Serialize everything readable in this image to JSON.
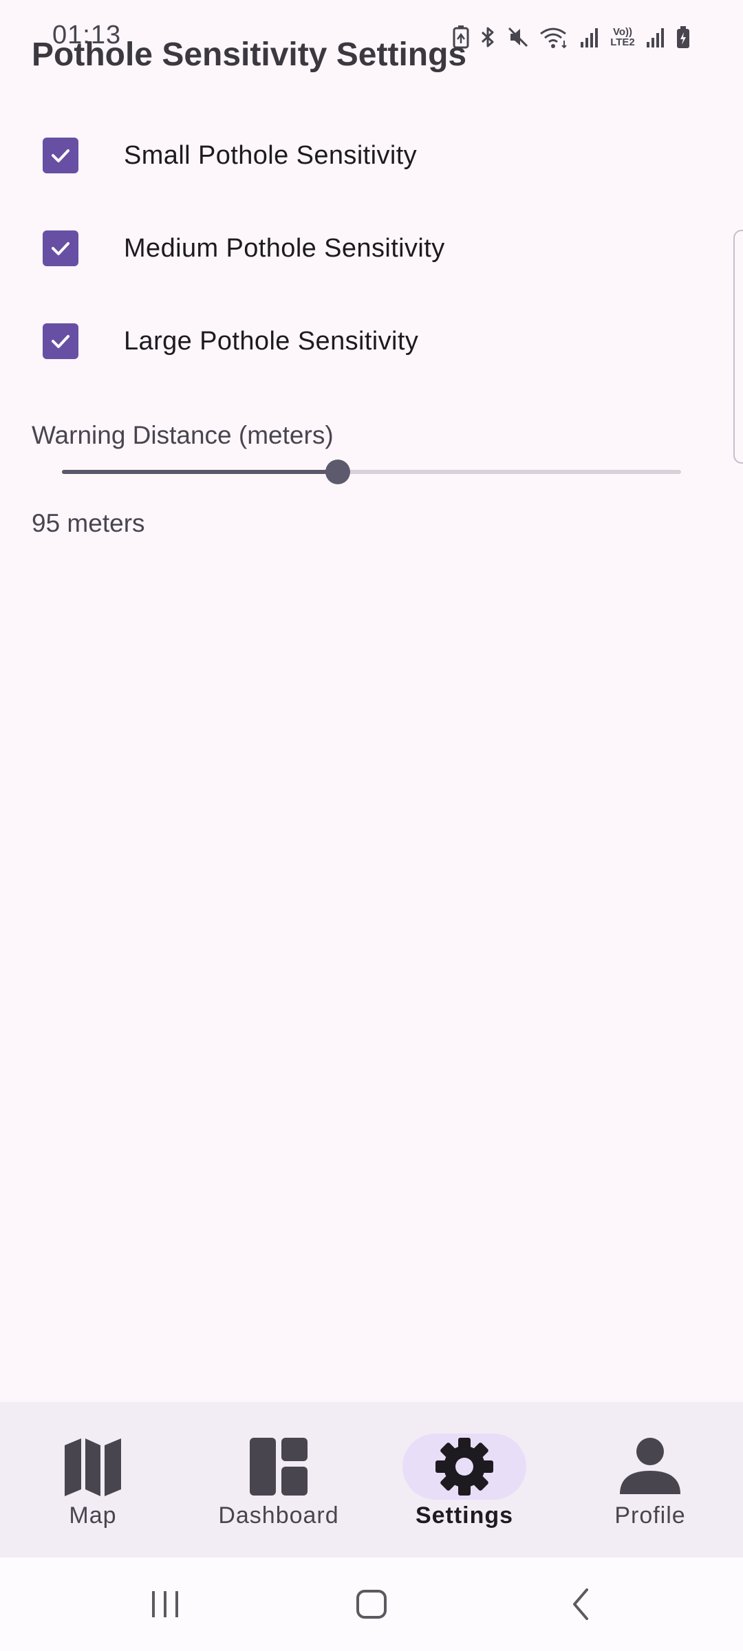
{
  "status_bar": {
    "time": "01:13",
    "icons": [
      "battery-saver-icon",
      "bluetooth-icon",
      "mute-icon",
      "wifi-icon",
      "signal-icon",
      "volte-icon",
      "signal-icon",
      "battery-icon"
    ],
    "volte_text": "Vo)) LTE2"
  },
  "page": {
    "title": "Pothole Sensitivity Settings"
  },
  "settings": {
    "checkboxes": [
      {
        "label": "Small Pothole Sensitivity",
        "checked": true
      },
      {
        "label": "Medium Pothole Sensitivity",
        "checked": true
      },
      {
        "label": "Large Pothole Sensitivity",
        "checked": true
      }
    ],
    "warning_distance": {
      "label": "Warning Distance (meters)",
      "value_text": "95 meters",
      "fraction": 0.445
    }
  },
  "bottom_nav": {
    "items": [
      {
        "label": "Map",
        "icon": "map-icon",
        "active": false
      },
      {
        "label": "Dashboard",
        "icon": "dashboard-icon",
        "active": false
      },
      {
        "label": "Settings",
        "icon": "gear-icon",
        "active": true
      },
      {
        "label": "Profile",
        "icon": "person-icon",
        "active": false
      }
    ]
  },
  "system_nav": {
    "buttons": [
      "recents-icon",
      "home-icon",
      "back-icon"
    ]
  },
  "colors": {
    "accent": "#6750a4",
    "background": "#fdf7fc",
    "nav_background": "#f2ecf5",
    "nav_active_pill": "#e8def8"
  }
}
